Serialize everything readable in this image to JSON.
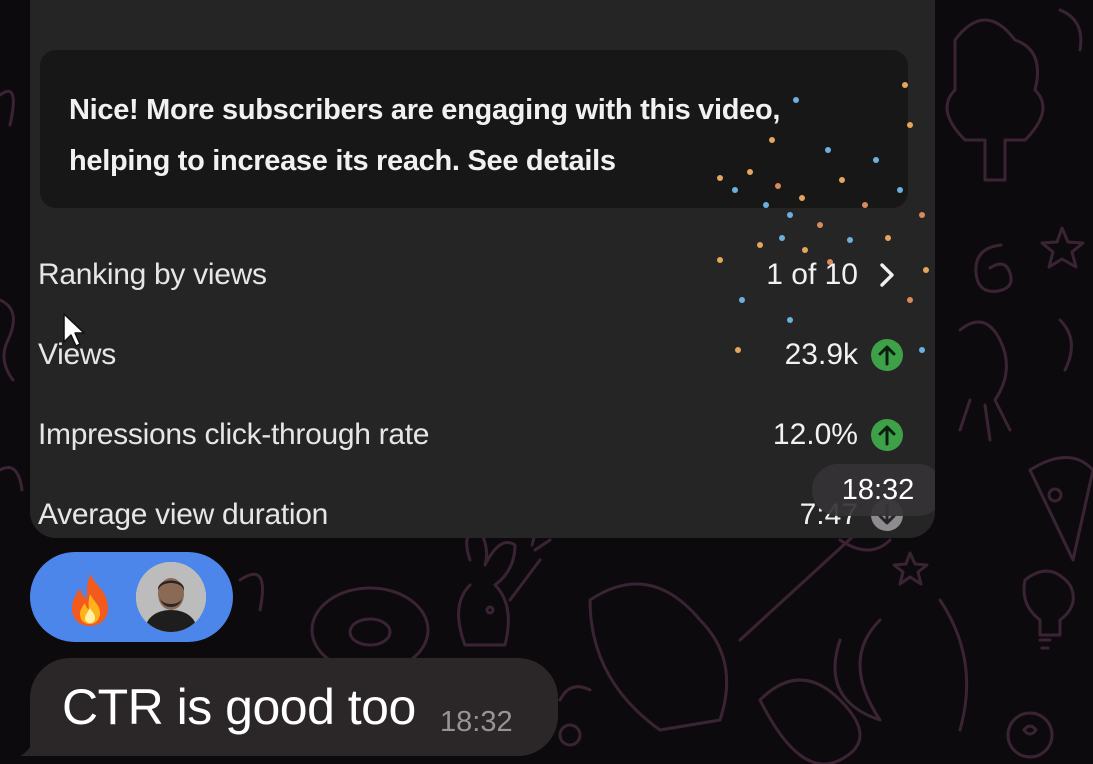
{
  "colors": {
    "background": "#0d0a0e",
    "doodle_stroke": "#3a2434",
    "bubble": "#262526",
    "card": "#171717",
    "up_arrow": "#3fa04a",
    "down_arrow": "#8e8c8e",
    "reaction_bg": "#4c86ea",
    "message_bubble": "#2b2627"
  },
  "media": {
    "info_card_text": "Nice! More subscribers are engaging with this video, helping to increase its reach. See details",
    "rows": [
      {
        "label": "Ranking by views",
        "value": "1 of 10",
        "icon": "chevron-right-icon"
      },
      {
        "label": "Views",
        "value": "23.9k",
        "icon": "arrow-up-icon"
      },
      {
        "label": "Impressions click-through rate",
        "value": "12.0%",
        "icon": "arrow-up-icon"
      },
      {
        "label": "Average view duration",
        "value": "7:47",
        "icon": "arrow-down-icon"
      }
    ],
    "timestamp": "18:32"
  },
  "reaction": {
    "emoji": "fire-emoji-icon",
    "avatar": "user-avatar"
  },
  "message": {
    "text": "CTR is good too",
    "time": "18:32"
  }
}
